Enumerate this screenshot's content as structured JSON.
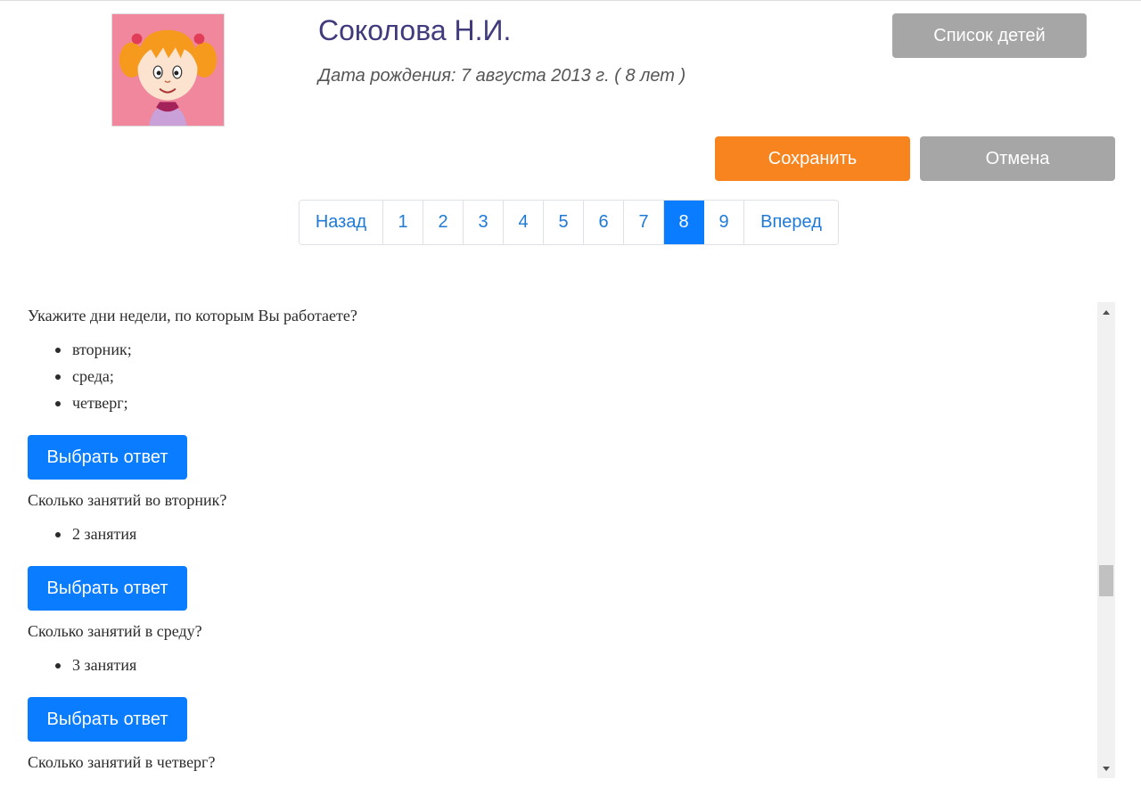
{
  "profile": {
    "avatar_icon": "girl-avatar-icon",
    "name": "Соколова Н.И.",
    "birth": "Дата рождения: 7 августа 2013 г. ( 8 лет )"
  },
  "actions": {
    "children_list": "Список детей",
    "save": "Сохранить",
    "cancel": "Отмена"
  },
  "pagination": {
    "prev": "Назад",
    "next": "Вперед",
    "pages": [
      "1",
      "2",
      "3",
      "4",
      "5",
      "6",
      "7",
      "8",
      "9"
    ],
    "current": "8"
  },
  "questions": [
    {
      "text": "Укажите дни недели, по которым Вы работаете?",
      "answers": [
        "вторник;",
        "среда;",
        "четверг;"
      ],
      "button": "Выбрать ответ"
    },
    {
      "text": "Сколько занятий во вторник?",
      "answers": [
        "2 занятия"
      ],
      "button": "Выбрать ответ"
    },
    {
      "text": "Сколько занятий в среду?",
      "answers": [
        "3 занятия"
      ],
      "button": "Выбрать ответ"
    },
    {
      "text": "Сколько занятий в четверг?",
      "answers": [],
      "button": ""
    }
  ],
  "colors": {
    "title": "#3f3b7c",
    "save": "#f7841f",
    "grey_button": "#a6a6a6",
    "primary": "#0a7cff"
  },
  "scroll": {
    "position": 0.62
  }
}
